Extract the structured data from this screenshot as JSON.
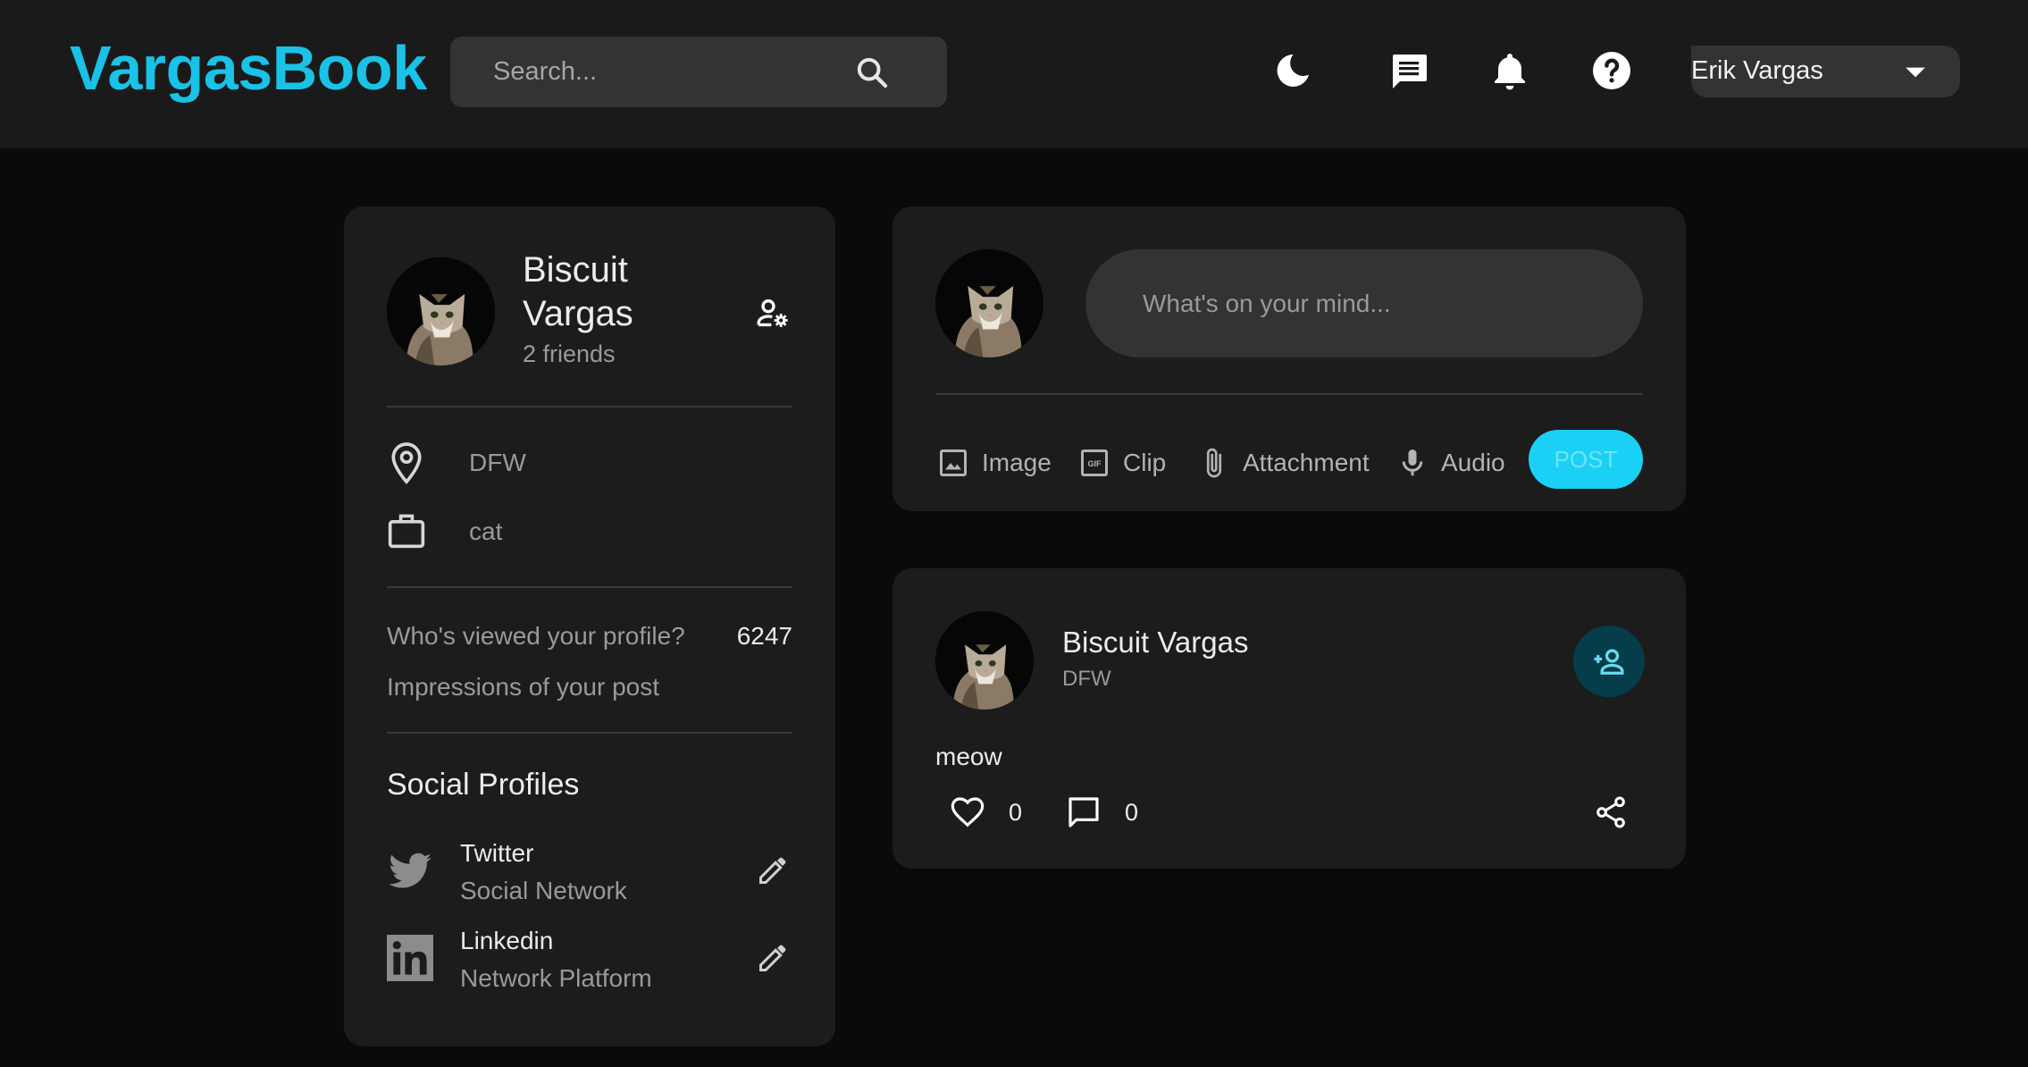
{
  "app": {
    "logo": "VargasBook",
    "accent_color": "#19c2e6"
  },
  "search": {
    "placeholder": "Search..."
  },
  "navbar": {
    "icons": [
      "moon-icon",
      "message-icon",
      "bell-icon",
      "help-icon"
    ],
    "user_select": {
      "selected": "Erik Vargas"
    }
  },
  "profile": {
    "name": "Biscuit Vargas",
    "friends": "2 friends",
    "location": "DFW",
    "occupation": "cat",
    "stats": [
      {
        "label": "Who's viewed your profile?",
        "value": "6247"
      },
      {
        "label": "Impressions of your post",
        "value": ""
      }
    ],
    "social_title": "Social Profiles",
    "socials": [
      {
        "name": "Twitter",
        "description": "Social Network",
        "icon": "twitter-icon"
      },
      {
        "name": "Linkedin",
        "description": "Network Platform",
        "icon": "linkedin-icon"
      }
    ]
  },
  "composer": {
    "placeholder": "What's on your mind...",
    "tools": [
      {
        "label": "Image",
        "icon": "image-icon"
      },
      {
        "label": "Clip",
        "icon": "gif-icon"
      },
      {
        "label": "Attachment",
        "icon": "paperclip-icon"
      },
      {
        "label": "Audio",
        "icon": "microphone-icon"
      }
    ],
    "post_label": "POST"
  },
  "post": {
    "author": "Biscuit Vargas",
    "location": "DFW",
    "text": "meow",
    "likes": "0",
    "comments": "0"
  }
}
